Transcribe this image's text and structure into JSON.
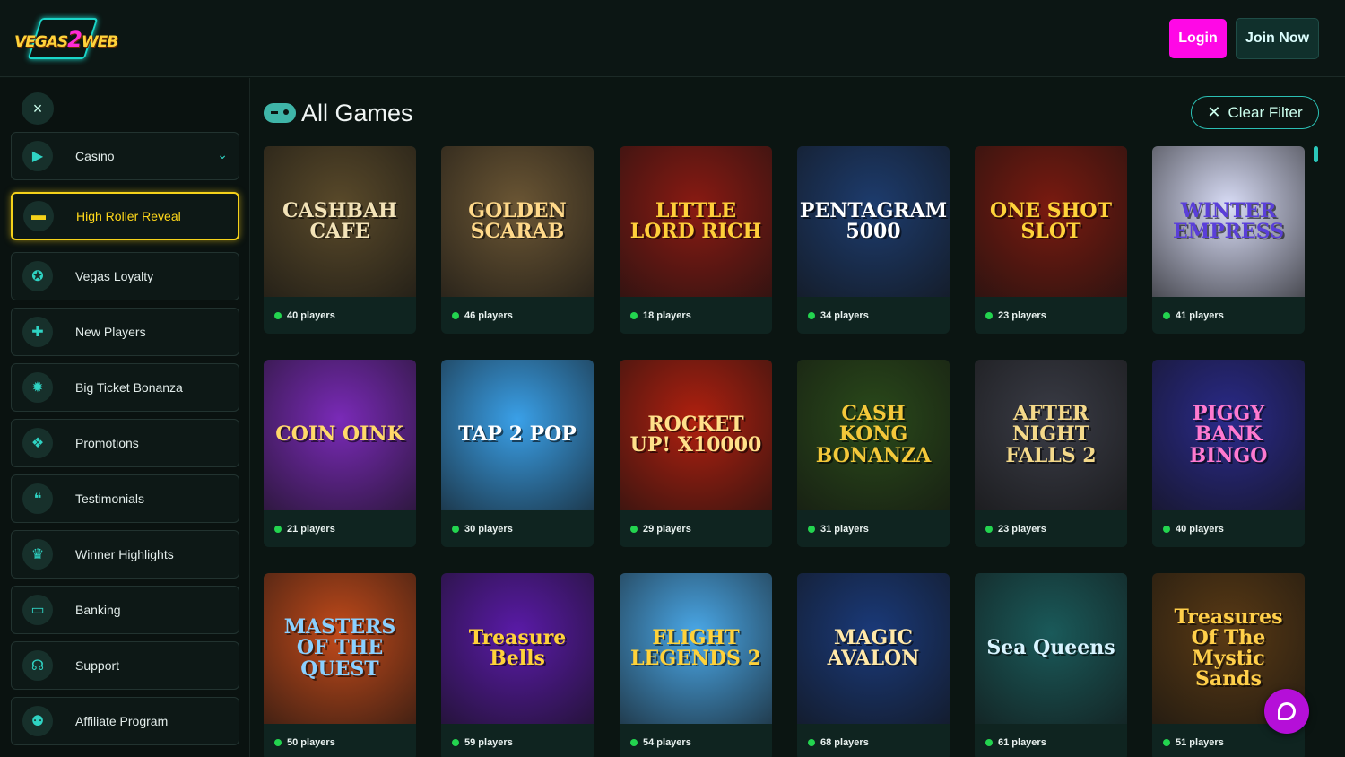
{
  "brand": {
    "logo_text_a": "VEGAS",
    "logo_text_b": "2",
    "logo_text_c": "WEB"
  },
  "header": {
    "login_label": "Login",
    "join_label": "Join Now"
  },
  "sidebar": {
    "close_icon": "×",
    "items": [
      {
        "label": "Casino",
        "icon": "play-icon",
        "glyph": "▶",
        "has_chevron": true
      },
      {
        "label": "High Roller Reveal",
        "icon": "ticket-icon",
        "glyph": "▬",
        "active": true
      },
      {
        "label": "Vegas Loyalty",
        "icon": "medal-icon",
        "glyph": "✪"
      },
      {
        "label": "New Players",
        "icon": "add-user-icon",
        "glyph": "✚"
      },
      {
        "label": "Big Ticket Bonanza",
        "icon": "gear-icon",
        "glyph": "✹"
      },
      {
        "label": "Promotions",
        "icon": "gift-icon",
        "glyph": "❖"
      },
      {
        "label": "Testimonials",
        "icon": "chat-icon",
        "glyph": "❝"
      },
      {
        "label": "Winner Highlights",
        "icon": "trophy-icon",
        "glyph": "♛"
      },
      {
        "label": "Banking",
        "icon": "card-icon",
        "glyph": "▭"
      },
      {
        "label": "Support",
        "icon": "headset-icon",
        "glyph": "☊"
      },
      {
        "label": "Affiliate Program",
        "icon": "group-icon",
        "glyph": "⚉"
      }
    ]
  },
  "main": {
    "title": "All Games",
    "clear_filter_label": "Clear Filter",
    "games": [
      {
        "title": "CASHBAH CAFE",
        "players": "40 players",
        "bg": "#5a4a2a",
        "fg": "#f3e3b8"
      },
      {
        "title": "GOLDEN SCARAB",
        "players": "46 players",
        "bg": "#6b5634",
        "fg": "#ffd98a"
      },
      {
        "title": "LITTLE LORD RICH",
        "players": "18 players",
        "bg": "#8a1a12",
        "fg": "#ffcf3a"
      },
      {
        "title": "PENTAGRAM 5000",
        "players": "34 players",
        "bg": "#1d3c6e",
        "fg": "#ffffff"
      },
      {
        "title": "ONE SHOT SLOT",
        "players": "23 players",
        "bg": "#7a1a10",
        "fg": "#ffd23a"
      },
      {
        "title": "WINTER EMPRESS",
        "players": "41 players",
        "bg": "#d9ddf7",
        "fg": "#5a3fd9"
      },
      {
        "title": "COIN OINK",
        "players": "21 players",
        "bg": "#7a2ab8",
        "fg": "#ffd96a"
      },
      {
        "title": "TAP 2 POP",
        "players": "30 players",
        "bg": "#3aa0e8",
        "fg": "#ffffff"
      },
      {
        "title": "ROCKET UP! X10000",
        "players": "29 players",
        "bg": "#b0200f",
        "fg": "#ffe08a"
      },
      {
        "title": "CASH KONG BONANZA",
        "players": "31 players",
        "bg": "#2a4a1a",
        "fg": "#f4c83a"
      },
      {
        "title": "AFTER NIGHT FALLS 2",
        "players": "23 players",
        "bg": "#3a3c46",
        "fg": "#f4d98a"
      },
      {
        "title": "PIGGY BANK BINGO",
        "players": "40 players",
        "bg": "#2a2a8a",
        "fg": "#ff7ad0"
      },
      {
        "title": "MASTERS OF THE QUEST",
        "players": "50 players",
        "bg": "#c24a1a",
        "fg": "#8ad0ff"
      },
      {
        "title": "Treasure Bells",
        "players": "59 players",
        "bg": "#5a1aa8",
        "fg": "#ffd23a"
      },
      {
        "title": "FLIGHT LEGENDS 2",
        "players": "54 players",
        "bg": "#4aa8e8",
        "fg": "#ffd23a"
      },
      {
        "title": "MAGIC AVALON",
        "players": "68 players",
        "bg": "#1a3a7a",
        "fg": "#ffe8a8"
      },
      {
        "title": "Sea Queens",
        "players": "61 players",
        "bg": "#1a5a5a",
        "fg": "#d8f4ff"
      },
      {
        "title": "Treasures Of The Mystic Sands",
        "players": "51 players",
        "bg": "#5a3a14",
        "fg": "#ffcf4a"
      }
    ]
  },
  "colors": {
    "accent": "#ff08e6",
    "teal": "#2bc7ba",
    "active": "#f5d21a",
    "online": "#23d44f"
  }
}
